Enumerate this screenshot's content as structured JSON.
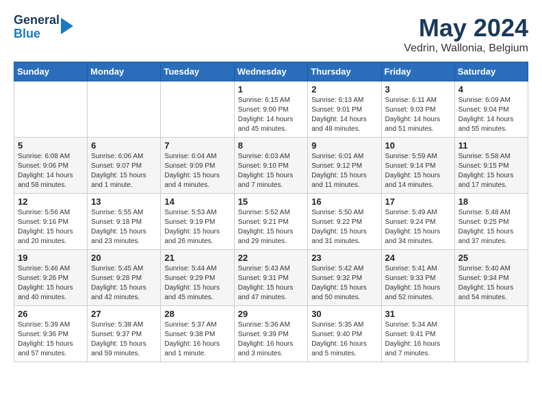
{
  "logo": {
    "line1": "General",
    "line2": "Blue"
  },
  "header": {
    "month": "May 2024",
    "location": "Vedrin, Wallonia, Belgium"
  },
  "weekdays": [
    "Sunday",
    "Monday",
    "Tuesday",
    "Wednesday",
    "Thursday",
    "Friday",
    "Saturday"
  ],
  "weeks": [
    [
      {
        "day": "",
        "info": ""
      },
      {
        "day": "",
        "info": ""
      },
      {
        "day": "",
        "info": ""
      },
      {
        "day": "1",
        "info": "Sunrise: 6:15 AM\nSunset: 9:00 PM\nDaylight: 14 hours\nand 45 minutes."
      },
      {
        "day": "2",
        "info": "Sunrise: 6:13 AM\nSunset: 9:01 PM\nDaylight: 14 hours\nand 48 minutes."
      },
      {
        "day": "3",
        "info": "Sunrise: 6:11 AM\nSunset: 9:03 PM\nDaylight: 14 hours\nand 51 minutes."
      },
      {
        "day": "4",
        "info": "Sunrise: 6:09 AM\nSunset: 9:04 PM\nDaylight: 14 hours\nand 55 minutes."
      }
    ],
    [
      {
        "day": "5",
        "info": "Sunrise: 6:08 AM\nSunset: 9:06 PM\nDaylight: 14 hours\nand 58 minutes."
      },
      {
        "day": "6",
        "info": "Sunrise: 6:06 AM\nSunset: 9:07 PM\nDaylight: 15 hours\nand 1 minute."
      },
      {
        "day": "7",
        "info": "Sunrise: 6:04 AM\nSunset: 9:09 PM\nDaylight: 15 hours\nand 4 minutes."
      },
      {
        "day": "8",
        "info": "Sunrise: 6:03 AM\nSunset: 9:10 PM\nDaylight: 15 hours\nand 7 minutes."
      },
      {
        "day": "9",
        "info": "Sunrise: 6:01 AM\nSunset: 9:12 PM\nDaylight: 15 hours\nand 11 minutes."
      },
      {
        "day": "10",
        "info": "Sunrise: 5:59 AM\nSunset: 9:14 PM\nDaylight: 15 hours\nand 14 minutes."
      },
      {
        "day": "11",
        "info": "Sunrise: 5:58 AM\nSunset: 9:15 PM\nDaylight: 15 hours\nand 17 minutes."
      }
    ],
    [
      {
        "day": "12",
        "info": "Sunrise: 5:56 AM\nSunset: 9:16 PM\nDaylight: 15 hours\nand 20 minutes."
      },
      {
        "day": "13",
        "info": "Sunrise: 5:55 AM\nSunset: 9:18 PM\nDaylight: 15 hours\nand 23 minutes."
      },
      {
        "day": "14",
        "info": "Sunrise: 5:53 AM\nSunset: 9:19 PM\nDaylight: 15 hours\nand 26 minutes."
      },
      {
        "day": "15",
        "info": "Sunrise: 5:52 AM\nSunset: 9:21 PM\nDaylight: 15 hours\nand 29 minutes."
      },
      {
        "day": "16",
        "info": "Sunrise: 5:50 AM\nSunset: 9:22 PM\nDaylight: 15 hours\nand 31 minutes."
      },
      {
        "day": "17",
        "info": "Sunrise: 5:49 AM\nSunset: 9:24 PM\nDaylight: 15 hours\nand 34 minutes."
      },
      {
        "day": "18",
        "info": "Sunrise: 5:48 AM\nSunset: 9:25 PM\nDaylight: 15 hours\nand 37 minutes."
      }
    ],
    [
      {
        "day": "19",
        "info": "Sunrise: 5:46 AM\nSunset: 9:26 PM\nDaylight: 15 hours\nand 40 minutes."
      },
      {
        "day": "20",
        "info": "Sunrise: 5:45 AM\nSunset: 9:28 PM\nDaylight: 15 hours\nand 42 minutes."
      },
      {
        "day": "21",
        "info": "Sunrise: 5:44 AM\nSunset: 9:29 PM\nDaylight: 15 hours\nand 45 minutes."
      },
      {
        "day": "22",
        "info": "Sunrise: 5:43 AM\nSunset: 9:31 PM\nDaylight: 15 hours\nand 47 minutes."
      },
      {
        "day": "23",
        "info": "Sunrise: 5:42 AM\nSunset: 9:32 PM\nDaylight: 15 hours\nand 50 minutes."
      },
      {
        "day": "24",
        "info": "Sunrise: 5:41 AM\nSunset: 9:33 PM\nDaylight: 15 hours\nand 52 minutes."
      },
      {
        "day": "25",
        "info": "Sunrise: 5:40 AM\nSunset: 9:34 PM\nDaylight: 15 hours\nand 54 minutes."
      }
    ],
    [
      {
        "day": "26",
        "info": "Sunrise: 5:39 AM\nSunset: 9:36 PM\nDaylight: 15 hours\nand 57 minutes."
      },
      {
        "day": "27",
        "info": "Sunrise: 5:38 AM\nSunset: 9:37 PM\nDaylight: 15 hours\nand 59 minutes."
      },
      {
        "day": "28",
        "info": "Sunrise: 5:37 AM\nSunset: 9:38 PM\nDaylight: 16 hours\nand 1 minute."
      },
      {
        "day": "29",
        "info": "Sunrise: 5:36 AM\nSunset: 9:39 PM\nDaylight: 16 hours\nand 3 minutes."
      },
      {
        "day": "30",
        "info": "Sunrise: 5:35 AM\nSunset: 9:40 PM\nDaylight: 16 hours\nand 5 minutes."
      },
      {
        "day": "31",
        "info": "Sunrise: 5:34 AM\nSunset: 9:41 PM\nDaylight: 16 hours\nand 7 minutes."
      },
      {
        "day": "",
        "info": ""
      }
    ]
  ]
}
